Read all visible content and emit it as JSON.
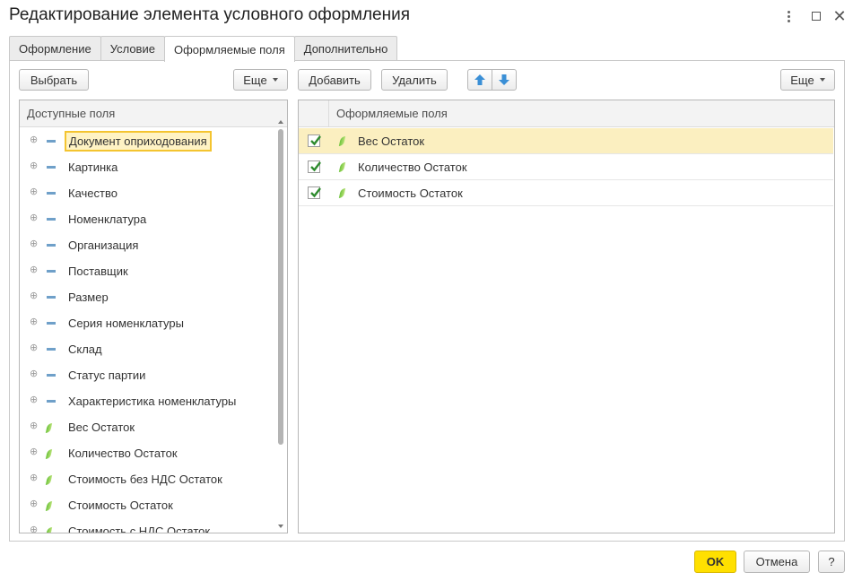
{
  "window": {
    "title": "Редактирование элемента условного оформления",
    "controls": {
      "more_icon": "kebab-icon",
      "maximize_icon": "maximize-icon",
      "close_icon": "close-icon"
    }
  },
  "tabs": [
    {
      "label": "Оформление",
      "active": false
    },
    {
      "label": "Условие",
      "active": false
    },
    {
      "label": "Оформляемые поля",
      "active": true
    },
    {
      "label": "Дополнительно",
      "active": false
    }
  ],
  "left_pane": {
    "toolbar": {
      "select_label": "Выбрать",
      "more_label": "Еще"
    },
    "header": "Доступные поля",
    "items": [
      {
        "label": "Документ оприходования",
        "icon": "field-group-icon",
        "selected": true
      },
      {
        "label": "Картинка",
        "icon": "field-group-icon"
      },
      {
        "label": "Качество",
        "icon": "field-group-icon"
      },
      {
        "label": "Номенклатура",
        "icon": "field-group-icon"
      },
      {
        "label": "Организация",
        "icon": "field-group-icon"
      },
      {
        "label": "Поставщик",
        "icon": "field-group-icon"
      },
      {
        "label": "Размер",
        "icon": "field-group-icon"
      },
      {
        "label": "Серия номенклатуры",
        "icon": "field-group-icon"
      },
      {
        "label": "Склад",
        "icon": "field-group-icon"
      },
      {
        "label": "Статус партии",
        "icon": "field-group-icon"
      },
      {
        "label": "Характеристика номенклатуры",
        "icon": "field-group-icon"
      },
      {
        "label": "Вес Остаток",
        "icon": "resource-icon"
      },
      {
        "label": "Количество Остаток",
        "icon": "resource-icon"
      },
      {
        "label": "Стоимость без НДС Остаток",
        "icon": "resource-icon"
      },
      {
        "label": "Стоимость Остаток",
        "icon": "resource-icon"
      },
      {
        "label": "Стоимость с НДС Остаток",
        "icon": "resource-icon"
      }
    ]
  },
  "right_pane": {
    "toolbar": {
      "add_label": "Добавить",
      "delete_label": "Удалить",
      "move_up_icon": "arrow-up-icon",
      "move_down_icon": "arrow-down-icon",
      "more_label": "Еще"
    },
    "header": "Оформляемые поля",
    "rows": [
      {
        "label": "Вес Остаток",
        "checked": true,
        "selected": true
      },
      {
        "label": "Количество Остаток",
        "checked": true
      },
      {
        "label": "Стоимость Остаток",
        "checked": true
      }
    ]
  },
  "footer": {
    "ok_label": "OK",
    "cancel_label": "Отмена",
    "help_label": "?"
  },
  "colors": {
    "ok_button": "#ffe000",
    "selection_fill": "#fbefc0",
    "selection_border": "#f4c430",
    "check_green": "#2e8b2e",
    "arrow_blue": "#3a8fd6"
  }
}
